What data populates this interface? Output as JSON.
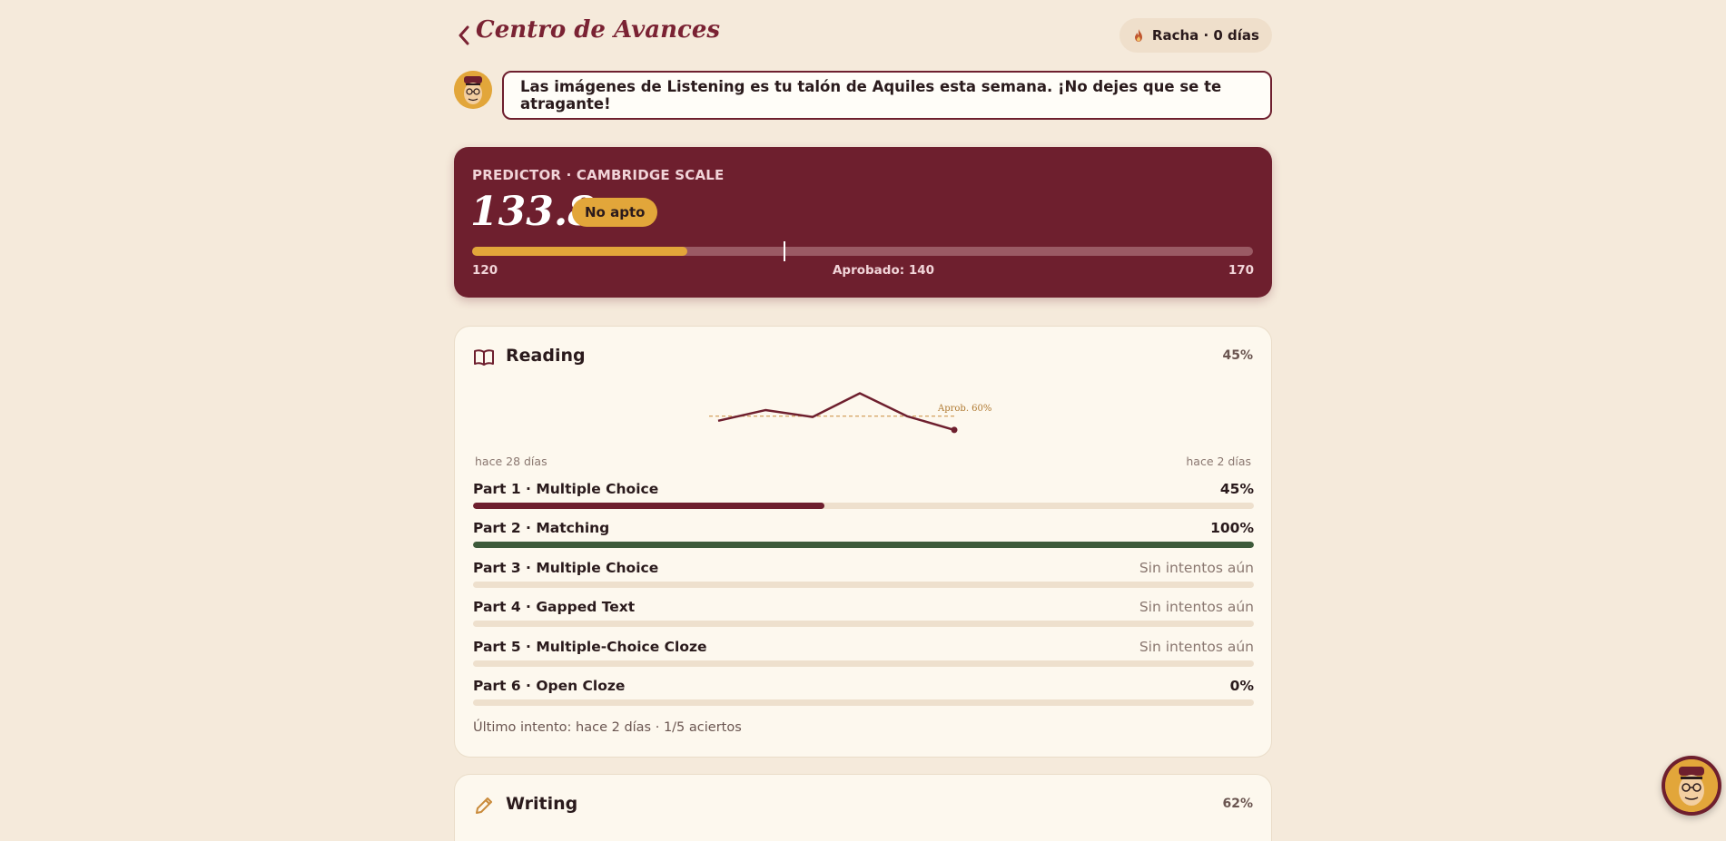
{
  "header": {
    "title": "Centro de Avances",
    "streak_label": "Racha · 0 días"
  },
  "coach": {
    "message": "Las imágenes de Listening es tu talón de Aquiles esta semana. ¡No dejes que se te atragante!"
  },
  "predictor": {
    "label": "PREDICTOR · CAMBRIDGE SCALE",
    "score": "133.8",
    "badge": "No apto",
    "min_label": "120",
    "pass_label": "Aprobado: 140",
    "max_label": "170",
    "scale_min": 120,
    "scale_max": 170,
    "score_value": 133.8,
    "pass_value": 140
  },
  "reading": {
    "title": "Reading",
    "percent": "45%",
    "sparkline": {
      "values": [
        24,
        38,
        29,
        60,
        30,
        12
      ],
      "threshold_label": "Aprob. 60%",
      "start_label": "hace 28 días",
      "end_label": "hace 2 días"
    },
    "parts": [
      {
        "name": "Part 1 · Multiple Choice",
        "value": "45%",
        "fill": 0.45,
        "color": "#6e1f2e",
        "muted": false
      },
      {
        "name": "Part 2 · Matching",
        "value": "100%",
        "fill": 1.0,
        "color": "#3d5a3a",
        "muted": false
      },
      {
        "name": "Part 3 · Multiple Choice",
        "value": "Sin intentos aún",
        "fill": 0,
        "color": "#6e1f2e",
        "muted": true
      },
      {
        "name": "Part 4 · Gapped Text",
        "value": "Sin intentos aún",
        "fill": 0,
        "color": "#6e1f2e",
        "muted": true
      },
      {
        "name": "Part 5 · Multiple-Choice Cloze",
        "value": "Sin intentos aún",
        "fill": 0,
        "color": "#6e1f2e",
        "muted": true
      },
      {
        "name": "Part 6 · Open Cloze",
        "value": "0%",
        "fill": 0,
        "color": "#6e1f2e",
        "muted": false
      }
    ],
    "last_attempt": "Último intento: hace 2 días · 1/5 aciertos"
  },
  "writing": {
    "title": "Writing",
    "percent": "62%"
  },
  "colors": {
    "background": "#f5eadb",
    "brand": "#6e1f2e",
    "accent": "#e2a63a",
    "success": "#3d5a3a"
  },
  "icons": {
    "back": "chevron-left-icon",
    "streak": "flame-icon",
    "reading": "book-icon",
    "writing": "pencil-icon",
    "mascot": "mascot-avatar"
  }
}
